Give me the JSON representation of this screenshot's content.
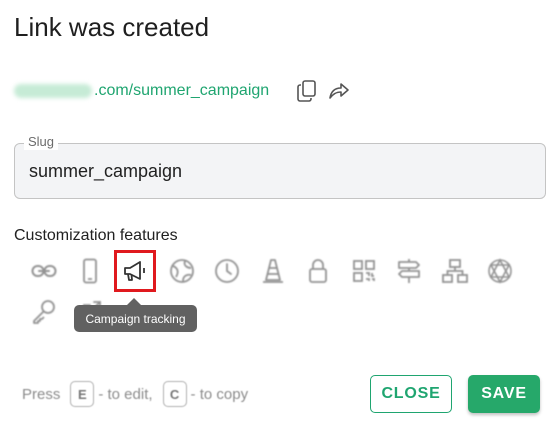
{
  "dialog": {
    "title": "Link was created"
  },
  "link": {
    "domain_blurred": "",
    "path": ".com/summer_campaign"
  },
  "slug": {
    "label": "Slug",
    "value": "summer_campaign"
  },
  "features": {
    "label": "Customization features",
    "items": [
      {
        "icon": "link-icon",
        "active": false
      },
      {
        "icon": "mobile-phone-icon",
        "active": false
      },
      {
        "icon": "megaphone-icon",
        "active": true
      },
      {
        "icon": "globe-icon",
        "active": false
      },
      {
        "icon": "clock-icon",
        "active": false
      },
      {
        "icon": "traffic-cone-icon",
        "active": false
      },
      {
        "icon": "lock-icon",
        "active": false
      },
      {
        "icon": "qr-code-icon",
        "active": false
      },
      {
        "icon": "signpost-icon",
        "active": false
      },
      {
        "icon": "sitemap-icon",
        "active": false
      },
      {
        "icon": "network-icon",
        "active": false
      },
      {
        "icon": "key-icon",
        "active": false
      },
      {
        "icon": "external-link-icon",
        "active": false
      }
    ],
    "tooltip": "Campaign tracking"
  },
  "hint": {
    "press": "Press",
    "edit_key": "E",
    "edit_text": "- to edit,",
    "copy_key": "C",
    "copy_text": "- to copy"
  },
  "actions": {
    "close": "CLOSE",
    "save": "SAVE"
  },
  "colors": {
    "accent": "#26a86a",
    "highlight": "#e0191e",
    "tooltip_bg": "#616161"
  }
}
